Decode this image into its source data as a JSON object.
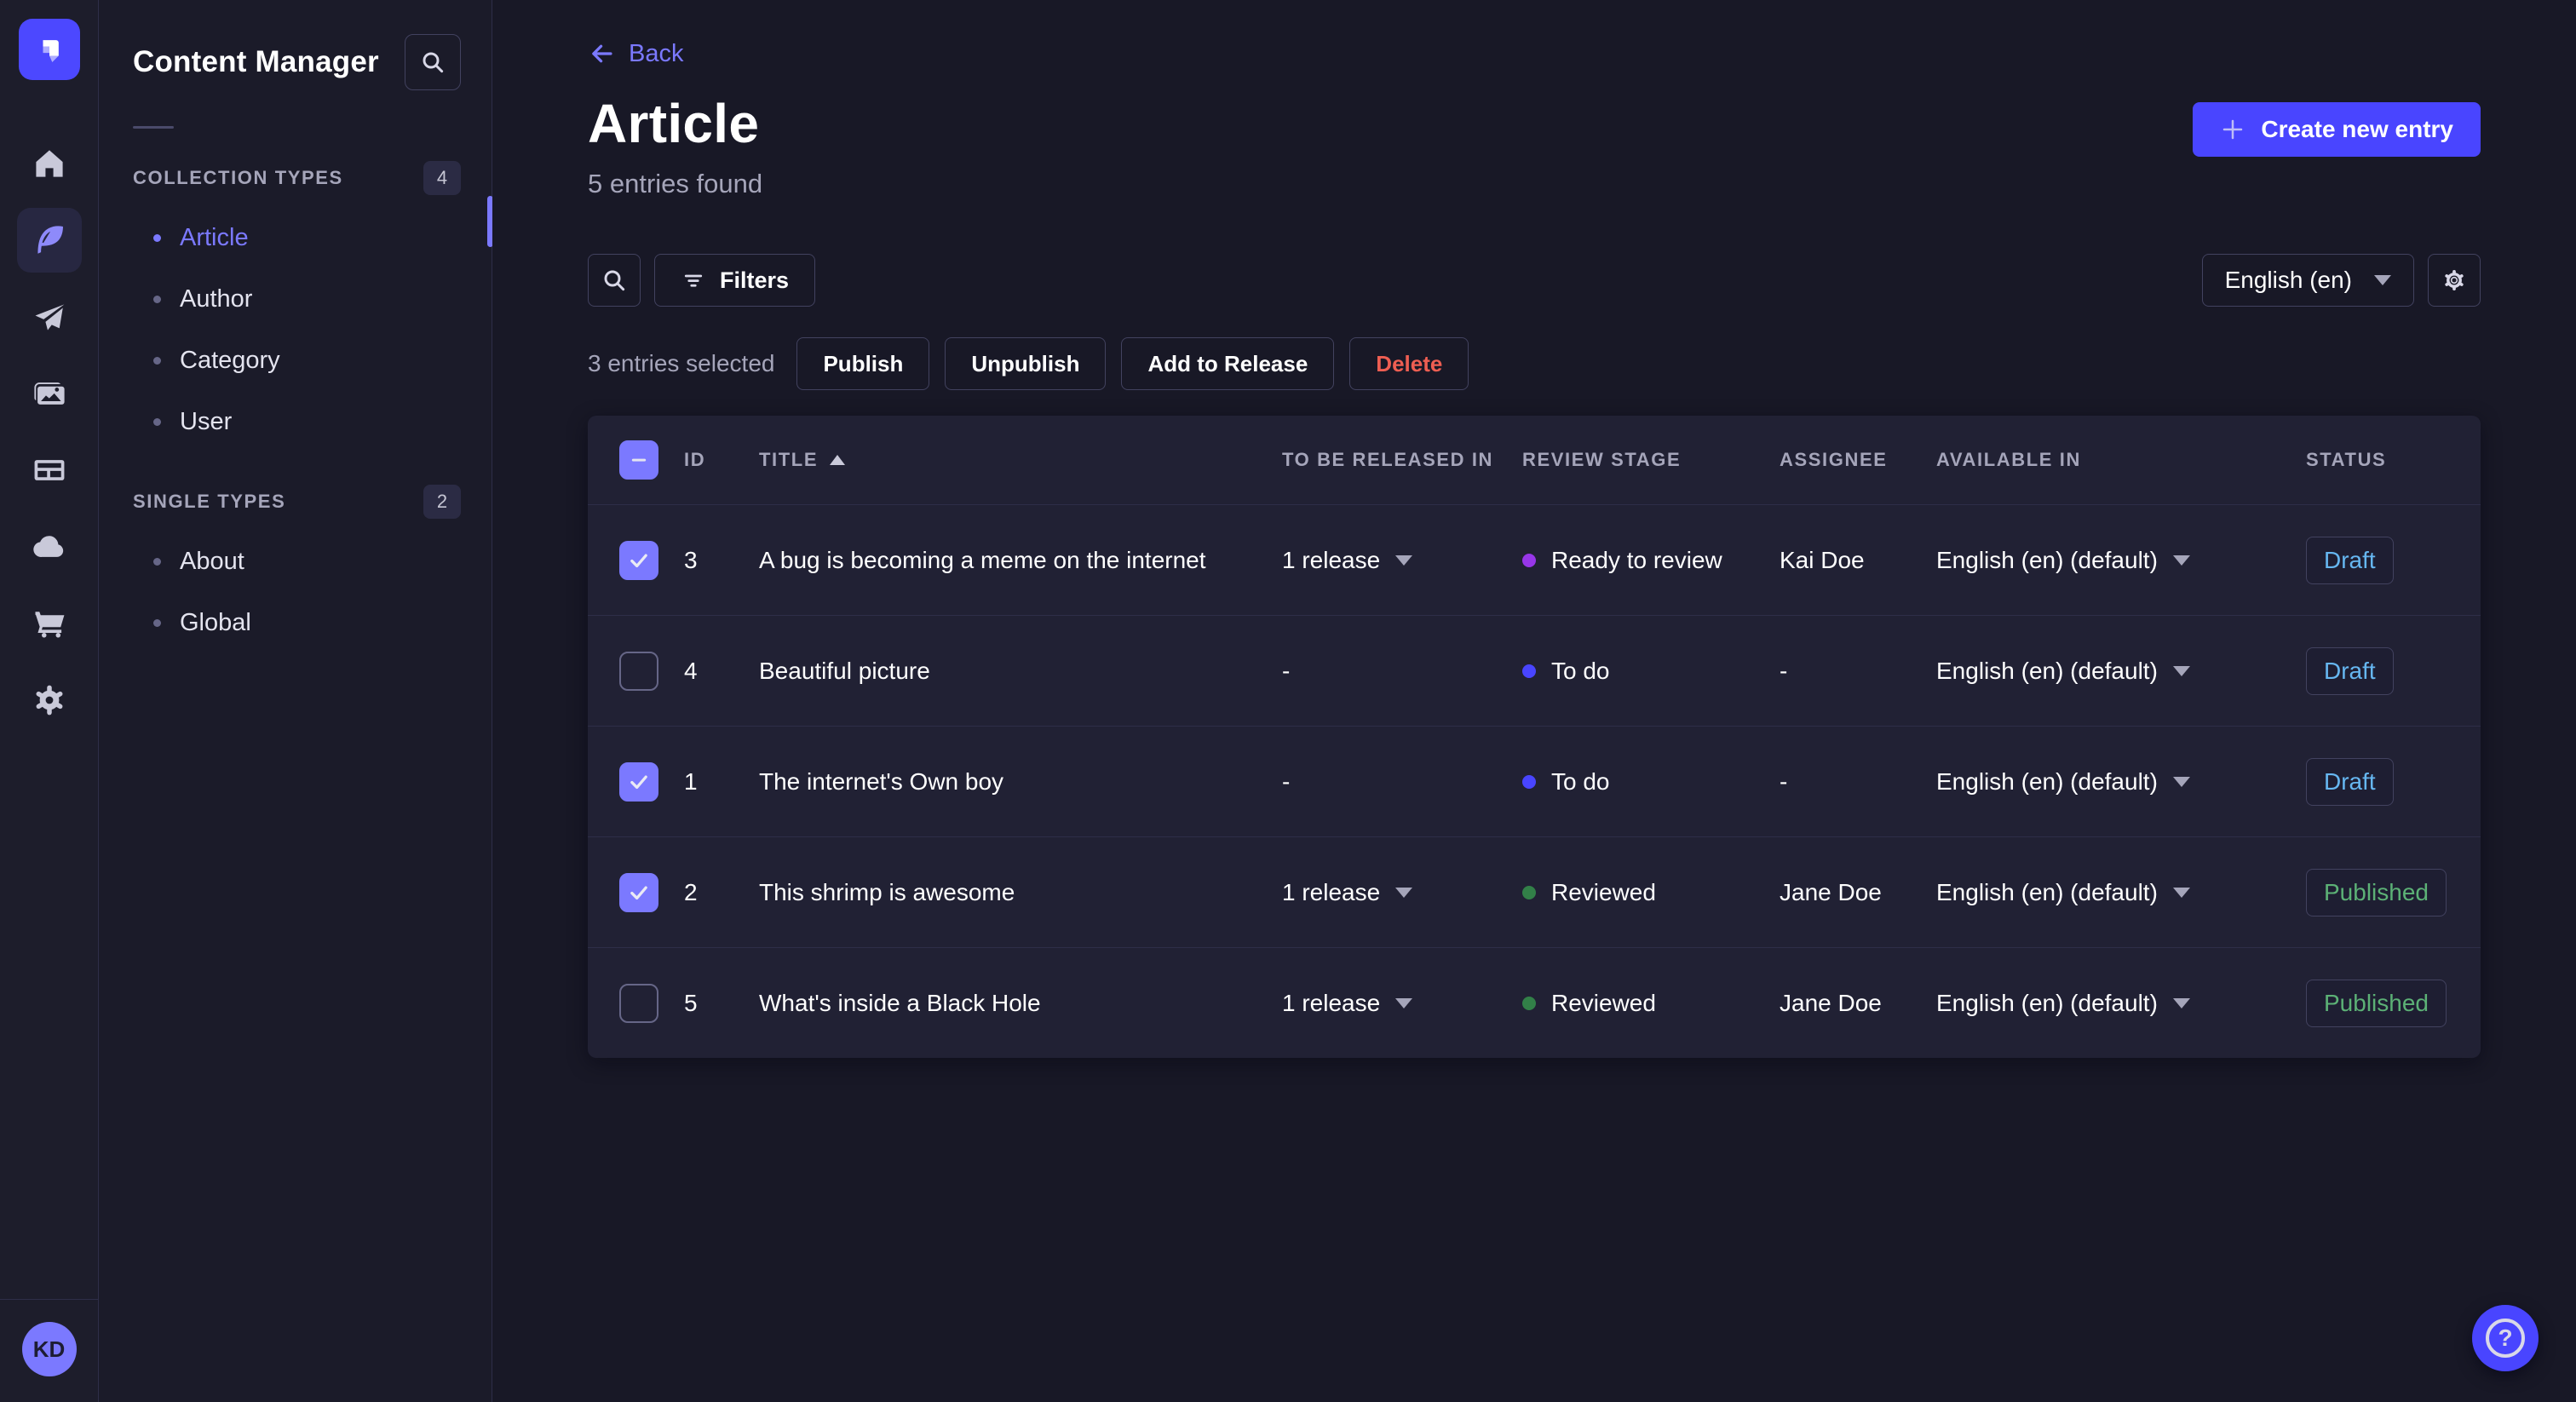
{
  "nav": {
    "logo_icon": "strapi-logo",
    "items": [
      {
        "name": "home",
        "icon": "home-icon",
        "active": false
      },
      {
        "name": "content-manager",
        "icon": "feather-icon",
        "active": true
      },
      {
        "name": "releases",
        "icon": "paper-plane-icon",
        "active": false
      },
      {
        "name": "media-library",
        "icon": "images-icon",
        "active": false
      },
      {
        "name": "content-type-builder",
        "icon": "layout-icon",
        "active": false
      },
      {
        "name": "deploy",
        "icon": "cloud-icon",
        "active": false
      },
      {
        "name": "marketplace",
        "icon": "cart-icon",
        "active": false
      },
      {
        "name": "settings",
        "icon": "gear-icon",
        "active": false
      }
    ],
    "avatar_initials": "KD"
  },
  "subnav": {
    "title": "Content Manager",
    "search_icon": "search-icon",
    "sections": [
      {
        "label": "COLLECTION TYPES",
        "count": "4",
        "items": [
          {
            "label": "Article",
            "active": true
          },
          {
            "label": "Author",
            "active": false
          },
          {
            "label": "Category",
            "active": false
          },
          {
            "label": "User",
            "active": false
          }
        ]
      },
      {
        "label": "SINGLE TYPES",
        "count": "2",
        "items": [
          {
            "label": "About",
            "active": false
          },
          {
            "label": "Global",
            "active": false
          }
        ]
      }
    ]
  },
  "header": {
    "back_label": "Back",
    "title": "Article",
    "subtitle": "5 entries found",
    "create_button_label": "Create new entry"
  },
  "toolbar": {
    "filters_label": "Filters",
    "locale_selected": "English (en)"
  },
  "selection": {
    "text": "3 entries selected",
    "actions": [
      {
        "label": "Publish",
        "variant": "default"
      },
      {
        "label": "Unpublish",
        "variant": "default"
      },
      {
        "label": "Add to Release",
        "variant": "default"
      },
      {
        "label": "Delete",
        "variant": "danger"
      }
    ]
  },
  "table": {
    "columns": [
      "ID",
      "TITLE",
      "TO BE RELEASED IN",
      "REVIEW STAGE",
      "ASSIGNEE",
      "AVAILABLE IN",
      "STATUS"
    ],
    "sorted_column": "TITLE",
    "sort_ascending": true,
    "header_checkbox_state": "indeterminate",
    "rows": [
      {
        "selected": true,
        "id": "3",
        "title": "A bug is becoming a meme on the internet",
        "released_in": "1 release",
        "released_caret": true,
        "stage": {
          "label": "Ready to review",
          "color": "#9736e8"
        },
        "assignee": "Kai Doe",
        "available_in": "English (en) (default)",
        "status": {
          "label": "Draft",
          "color": "#66b7f1"
        }
      },
      {
        "selected": false,
        "id": "4",
        "title": "Beautiful picture",
        "released_in": "-",
        "released_caret": false,
        "stage": {
          "label": "To do",
          "color": "#4945ff"
        },
        "assignee": "-",
        "available_in": "English (en) (default)",
        "status": {
          "label": "Draft",
          "color": "#66b7f1"
        }
      },
      {
        "selected": true,
        "id": "1",
        "title": "The internet's Own boy",
        "released_in": "-",
        "released_caret": false,
        "stage": {
          "label": "To do",
          "color": "#4945ff"
        },
        "assignee": "-",
        "available_in": "English (en) (default)",
        "status": {
          "label": "Draft",
          "color": "#66b7f1"
        }
      },
      {
        "selected": true,
        "id": "2",
        "title": "This shrimp is awesome",
        "released_in": "1 release",
        "released_caret": true,
        "stage": {
          "label": "Reviewed",
          "color": "#328048"
        },
        "assignee": "Jane Doe",
        "available_in": "English (en) (default)",
        "status": {
          "label": "Published",
          "color": "#5cb176"
        }
      },
      {
        "selected": false,
        "id": "5",
        "title": "What's inside a Black Hole",
        "released_in": "1 release",
        "released_caret": true,
        "stage": {
          "label": "Reviewed",
          "color": "#328048"
        },
        "assignee": "Jane Doe",
        "available_in": "English (en) (default)",
        "status": {
          "label": "Published",
          "color": "#5cb176"
        }
      }
    ]
  },
  "help": {
    "icon": "question-mark-icon"
  },
  "colors": {
    "accent": "#4945ff",
    "accent_light": "#7b79ff",
    "danger": "#ee5e52",
    "surface": "#212134",
    "page_background": "#181826",
    "border": "#42425f",
    "muted_text": "#a5a5ba"
  }
}
